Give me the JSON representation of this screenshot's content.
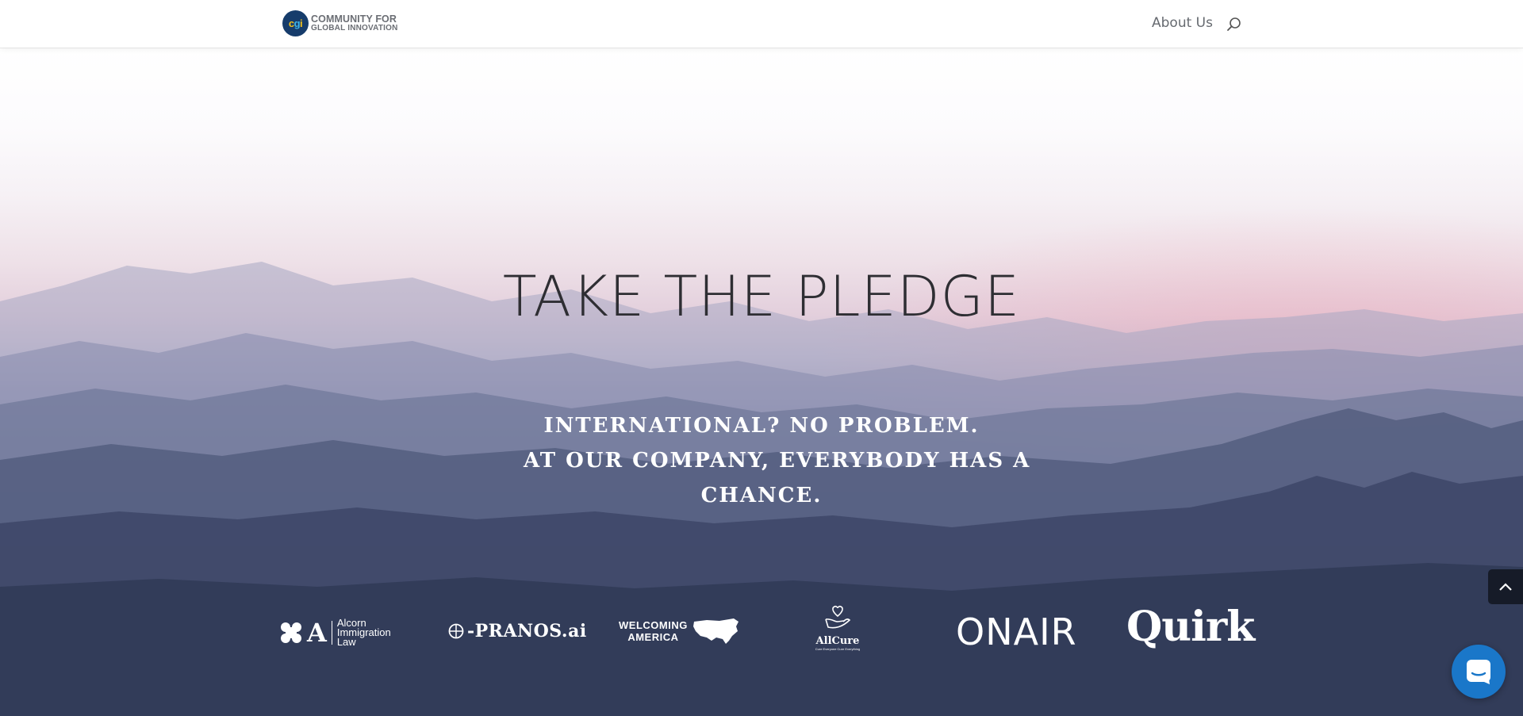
{
  "header": {
    "logo": {
      "mark_c": "c",
      "mark_g": "g",
      "mark_i": "i",
      "line1": "COMMUNITY FOR",
      "line2": "GLOBAL INNOVATION"
    },
    "nav": [
      {
        "label": "About Us"
      }
    ],
    "search_icon": "search-icon"
  },
  "hero": {
    "title": "TAKE THE PLEDGE",
    "subtitle_lines": [
      "INTERNATIONAL? NO PROBLEM.",
      "AT OUR COMPANY, EVERYBODY HAS A",
      "CHANCE."
    ]
  },
  "partners": [
    {
      "name": "Alcorn Immigration Law",
      "mark": "A",
      "lines": [
        "Alcorn",
        "Immigration",
        "Law"
      ]
    },
    {
      "name": "PRANOS.ai",
      "text": "-PRANOS.ai"
    },
    {
      "name": "Welcoming America",
      "lines": [
        "WELCOMING",
        "AMERICA"
      ]
    },
    {
      "name": "AllCure",
      "text": "AllCure",
      "tagline": "Cure Everyone Cure Everything"
    },
    {
      "name": "ONAIR",
      "text": "ONAIR"
    },
    {
      "name": "Quirk",
      "text": "Quirk"
    }
  ],
  "widgets": {
    "back_to_top_icon": "chevron-up-icon",
    "chat_icon": "chat-bubble-icon"
  },
  "colors": {
    "header_bg": "#ffffff",
    "nav_text": "#666a70",
    "title_text": "#2e2e33",
    "chat_blue": "#1a77c9",
    "logo_navy": "#163c6b"
  }
}
